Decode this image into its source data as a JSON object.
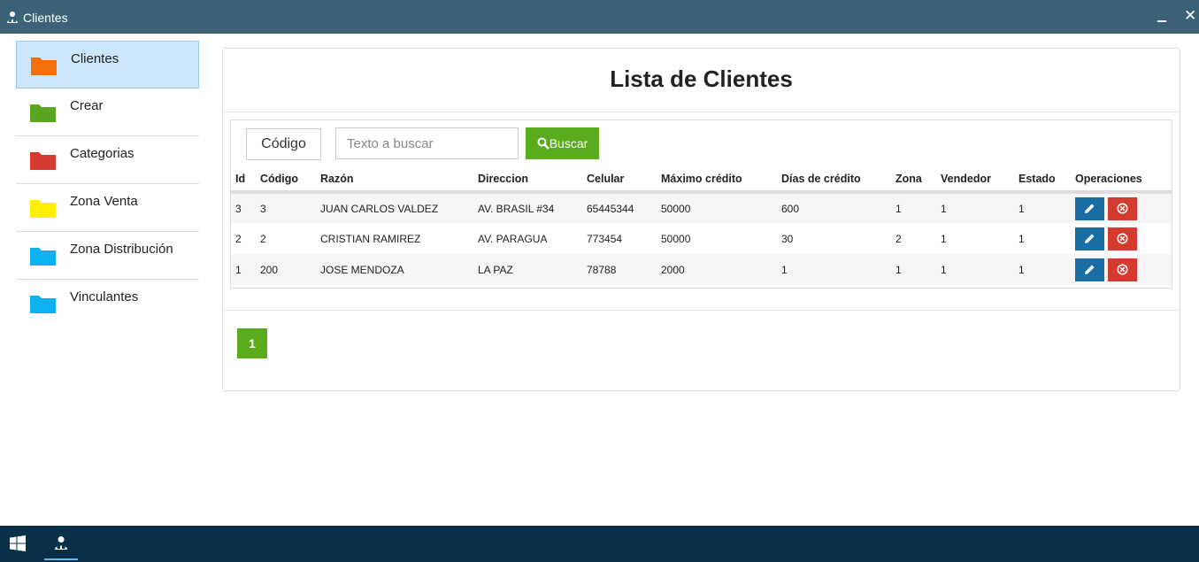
{
  "window": {
    "title": "Clientes",
    "app_icon": "users-icon",
    "minimize_icon": "minimize-icon",
    "close_symbol": "✕"
  },
  "sidebar": {
    "items": [
      {
        "label": "Clientes",
        "color": "#f26f0c",
        "active": true
      },
      {
        "label": "Crear",
        "color": "#5aa51f"
      },
      {
        "label": "Categorias",
        "color": "#d6392f"
      },
      {
        "label": "Zona Venta",
        "color": "#ffef00"
      },
      {
        "label": "Zona Distribución",
        "color": "#0cb1f0"
      },
      {
        "label": "Vinculantes",
        "color": "#0cb1f0"
      }
    ]
  },
  "main": {
    "title": "Lista de Clientes",
    "search": {
      "field_label": "Código",
      "placeholder": "Texto a buscar",
      "value": "",
      "button_label": "Buscar"
    },
    "table": {
      "headers": [
        "Id",
        "Código",
        "Razón",
        "Direccion",
        "Celular",
        "Máximo crédito",
        "Días de crédito",
        "Zona",
        "Vendedor",
        "Estado",
        "Operaciones"
      ],
      "rows": [
        [
          "3",
          "3",
          "JUAN CARLOS VALDEZ",
          "AV. BRASIL #34",
          "65445344",
          "50000",
          "600",
          "1",
          "1",
          "1"
        ],
        [
          "2",
          "2",
          "CRISTIAN RAMIREZ",
          "AV. PARAGUA",
          "773454",
          "50000",
          "30",
          "2",
          "1",
          "1"
        ],
        [
          "1",
          "200",
          "JOSE MENDOZA",
          "LA PAZ",
          "78788",
          "2000",
          "1",
          "1",
          "1",
          "1"
        ]
      ]
    },
    "pagination": {
      "current_page": "1"
    }
  },
  "colors": {
    "titlebar": "#3c6278",
    "accent_green": "#5aac1c",
    "edit_blue": "#1a6ea4",
    "delete_red": "#d43b30",
    "taskbar": "#083049"
  }
}
